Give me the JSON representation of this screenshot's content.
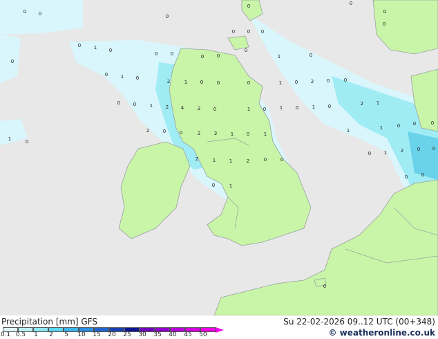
{
  "map": {
    "cell_values": [
      "0",
      "0",
      "0",
      "0",
      "0",
      "0",
      "0",
      "0",
      "0",
      "0",
      "0",
      "1",
      "0",
      "0",
      "0",
      "0",
      "0",
      "0",
      "1",
      "0",
      "0",
      "0",
      "1",
      "0",
      "2",
      "1",
      "0",
      "0",
      "0",
      "1",
      "0",
      "2",
      "0",
      "0",
      "0",
      "0",
      "1",
      "2",
      "4",
      "2",
      "0",
      "1",
      "0",
      "1",
      "0",
      "1",
      "0",
      "2",
      "1",
      "2",
      "0",
      "0",
      "2",
      "3",
      "1",
      "0",
      "1",
      "1",
      "1",
      "0",
      "0",
      "0",
      "1",
      "0",
      "2",
      "1",
      "1",
      "2",
      "0",
      "0",
      "0",
      "1",
      "2",
      "0",
      "0",
      "0",
      "0",
      "0",
      "1",
      "0"
    ],
    "colors": {
      "sea": "#e8e8e8",
      "land": "#c8f5a8",
      "border": "#9aa0a0",
      "precip_light": "#d8f6fc",
      "precip_mid": "#a0ecf4",
      "precip_heavy": "#6ad2ea",
      "precip_peak": "#4cb8e0"
    }
  },
  "legend": {
    "title": "Precipitation [mm]  GFS",
    "ticks": [
      "0.1",
      "0.5",
      "1",
      "2",
      "5",
      "10",
      "15",
      "20",
      "25",
      "30",
      "35",
      "40",
      "45",
      "50"
    ],
    "colors": [
      "#e0f8fc",
      "#b8f0f8",
      "#8ce6f4",
      "#5cd6f0",
      "#3cb4e8",
      "#2c8ce0",
      "#2464cc",
      "#1c40b0",
      "#101890",
      "#7000b8",
      "#9000c8",
      "#b400d4",
      "#d400dc",
      "#f000e8"
    ]
  },
  "run_info": "Su 22-02-2026 09..12 UTC (00+348)",
  "credit": "© weatheronline.co.uk"
}
